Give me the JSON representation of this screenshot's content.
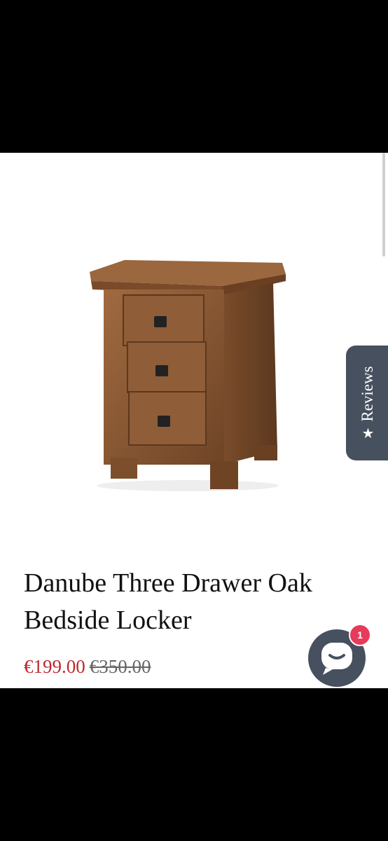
{
  "product": {
    "image_alt": "Danube Three Drawer Oak Bedside Locker",
    "title": "Danube Three Drawer Oak Bedside Locker",
    "price_sale": "€199.00",
    "price_original": "€350.00"
  },
  "reviews_tab": {
    "label": "Reviews",
    "icon": "star-icon"
  },
  "chat": {
    "icon": "chat-bubble-icon",
    "badge_count": "1"
  },
  "colors": {
    "sale_price": "#c0282d",
    "tab_background": "#46505e",
    "badge": "#e63b5a",
    "wood": "#8a5a35"
  }
}
